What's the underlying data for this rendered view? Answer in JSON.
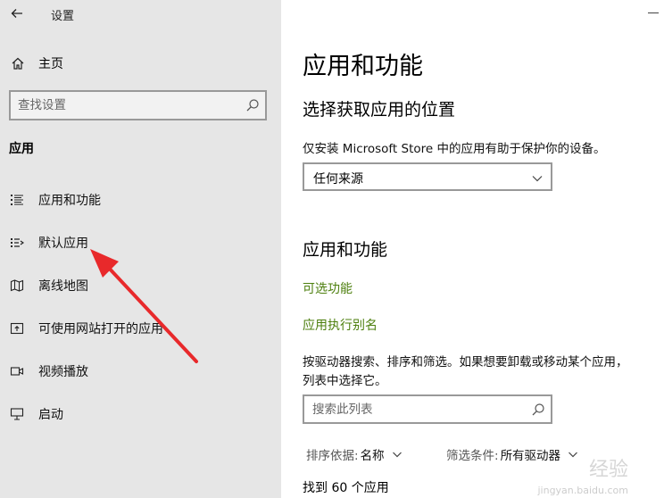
{
  "window": {
    "title": "设置"
  },
  "sidebar": {
    "home": "主页",
    "search_placeholder": "查找设置",
    "section": "应用",
    "items": [
      {
        "label": "应用和功能",
        "icon": "list-icon"
      },
      {
        "label": "默认应用",
        "icon": "default-apps-icon"
      },
      {
        "label": "离线地图",
        "icon": "map-icon"
      },
      {
        "label": "可使用网站打开的应用",
        "icon": "open-in-icon"
      },
      {
        "label": "视频播放",
        "icon": "video-icon"
      },
      {
        "label": "启动",
        "icon": "startup-icon"
      }
    ]
  },
  "main": {
    "title": "应用和功能",
    "section1_title": "选择获取应用的位置",
    "section1_desc": "仅安装 Microsoft Store 中的应用有助于保护你的设备。",
    "source_select": "任何来源",
    "section2_title": "应用和功能",
    "link_optional": "可选功能",
    "link_alias": "应用执行别名",
    "para_line1": "按驱动器搜索、排序和筛选。如果想要卸载或移动某个应用，",
    "para_line2": "列表中选择它。",
    "search_placeholder": "搜索此列表",
    "sort_label": "排序依据:",
    "sort_value": "名称",
    "filter_label": "筛选条件:",
    "filter_value": "所有驱动器",
    "count_text": "找到 60 个应用"
  },
  "watermark": {
    "text": "经验",
    "url": "jingyan.baidu.com"
  },
  "colors": {
    "sidebar_bg": "#e6e6e6",
    "link": "#4d7f0e",
    "arrow": "#e8292b"
  }
}
